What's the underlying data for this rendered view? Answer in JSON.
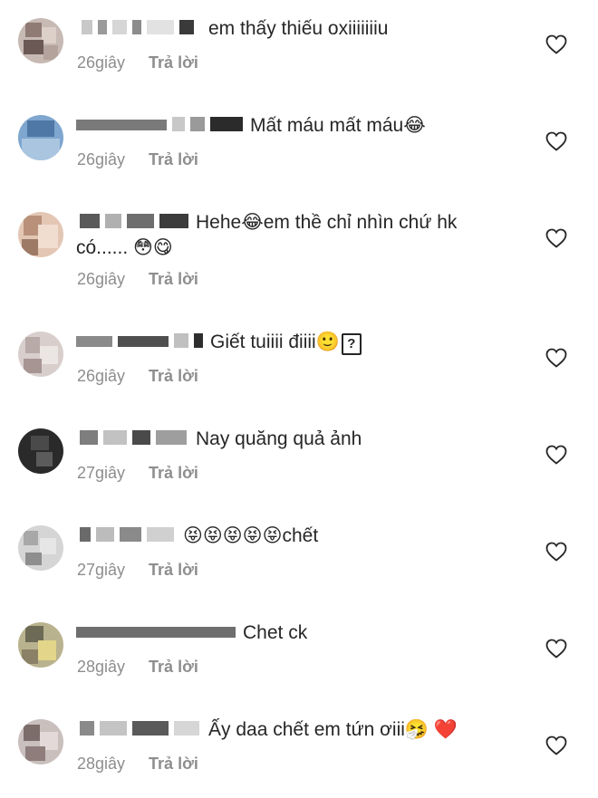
{
  "comments": [
    {
      "text": "em thấy thiếu oxiiiiiiiu",
      "time": "26giây",
      "reply": "Trả lời"
    },
    {
      "text": "Mất máu mất máu😂",
      "time": "26giây",
      "reply": "Trả lời"
    },
    {
      "text": "Hehe😂em thề chỉ nhìn chứ hk",
      "text2": "có...... 😳😋",
      "time": "26giây",
      "reply": "Trả lời"
    },
    {
      "text": "Giết tuiiii điiii🙂",
      "time": "26giây",
      "reply": "Trả lời",
      "unknown_glyph": "?"
    },
    {
      "text": "Nay quăng quả ảnh",
      "time": "27giây",
      "reply": "Trả lời"
    },
    {
      "text": "😝😝😝😝😝chết",
      "time": "27giây",
      "reply": "Trả lời"
    },
    {
      "text": "Chet ck",
      "time": "28giây",
      "reply": "Trả lời"
    },
    {
      "text": "Ấy daa chết em tứn ơiii🤧 ❤️",
      "time": "28giây",
      "reply": "Trả lời"
    }
  ],
  "colors": {
    "text": "#262626",
    "meta": "#8e8e8e",
    "icon": "#262626"
  },
  "icons": {
    "like": "heart-outline-icon"
  }
}
